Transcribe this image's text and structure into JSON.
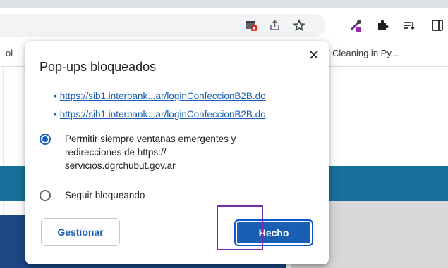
{
  "toolbar": {
    "icons": [
      "popup-blocked-icon",
      "share-icon",
      "star-icon",
      "eyedropper-extension-icon",
      "puzzle-extensions-icon",
      "reading-list-icon",
      "side-panel-icon"
    ]
  },
  "bookmarks_bar": {
    "left_fragment": "ol",
    "right_item": "Cleaning in Py..."
  },
  "popup": {
    "title": "Pop-ups bloqueados",
    "links": [
      "https://sib1.interbank...ar/loginConfeccionB2B.do",
      "https://sib1.interbank...ar/loginConfeccionB2B.do"
    ],
    "options": [
      {
        "label_lines": [
          "Permitir siempre ventanas emergentes y",
          "redirecciones de https://",
          "servicios.dgrchubut.gov.ar"
        ],
        "selected": true
      },
      {
        "label_lines": [
          "Seguir bloqueando"
        ],
        "selected": false
      }
    ],
    "manage_button": "Gestionar",
    "done_button": "Hecho"
  },
  "colors": {
    "accent": "#1a5fb4",
    "page_blue_band": "#17719a",
    "page_navy": "#1e4785",
    "highlight": "#7b2fa6"
  }
}
